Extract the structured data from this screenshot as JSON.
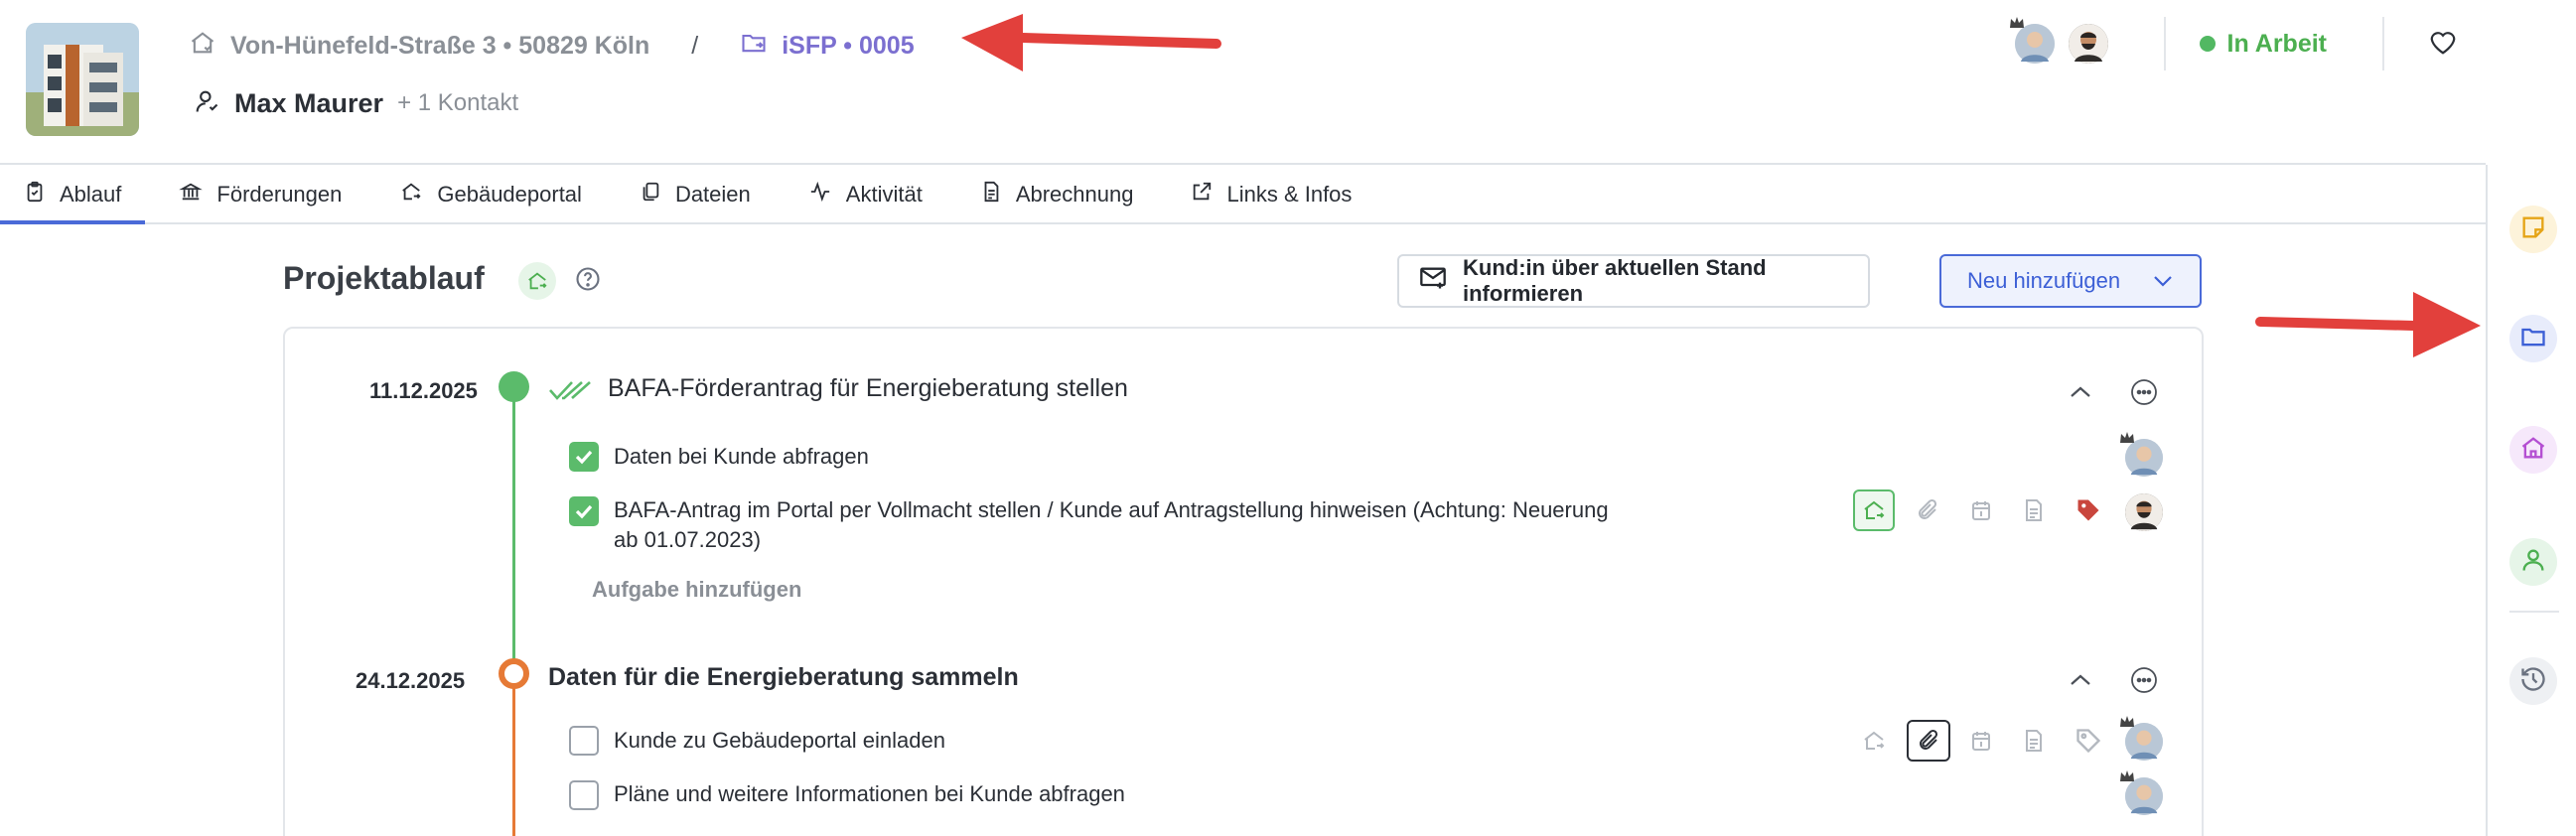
{
  "header": {
    "address": "Von-Hünefeld-Straße 3 • 50829 Köln",
    "separator": "/",
    "project": "iSFP • 0005",
    "contact_name": "Max Maurer",
    "contact_extra": "+ 1 Kontakt",
    "status": "In Arbeit",
    "status_color": "#52b862"
  },
  "tabs": [
    {
      "label": "Ablauf",
      "icon": "clipboard-check-icon",
      "active": true
    },
    {
      "label": "Förderungen",
      "icon": "bank-icon"
    },
    {
      "label": "Gebäudeportal",
      "icon": "house-share-icon"
    },
    {
      "label": "Dateien",
      "icon": "files-icon"
    },
    {
      "label": "Aktivität",
      "icon": "activity-icon"
    },
    {
      "label": "Abrechnung",
      "icon": "receipt-icon"
    },
    {
      "label": "Links & Infos",
      "icon": "external-link-icon"
    }
  ],
  "main": {
    "title": "Projektablauf",
    "inform_button": "Kund:in über aktuellen Stand informieren",
    "new_button": "Neu hinzufügen"
  },
  "timeline": [
    {
      "date": "11.12.2025",
      "title": "BAFA-Förderantrag für Energieberatung stellen",
      "status": "done",
      "tasks": [
        {
          "label": "Daten bei Kunde abfragen",
          "checked": true
        },
        {
          "label_line1": "BAFA-Antrag im Portal per Vollmacht stellen / Kunde auf Antragstellung hinweisen (Achtung: Neuerung",
          "label_line2": "ab 01.07.2023)",
          "checked": true
        }
      ],
      "add_task": "Aufgabe hinzufügen"
    },
    {
      "date": "24.12.2025",
      "title": "Daten für die Energieberatung sammeln",
      "status": "in-progress",
      "tasks": [
        {
          "label": "Kunde zu Gebäudeportal einladen",
          "checked": false
        },
        {
          "label": "Pläne und weitere Informationen bei Kunde abfragen",
          "checked": false
        }
      ]
    }
  ],
  "colors": {
    "accent": "#4a6ad8",
    "done": "#5bbb6b",
    "in_progress": "#e67a36",
    "project_link": "#7b6fd0",
    "tag_red": "#c9463d"
  }
}
